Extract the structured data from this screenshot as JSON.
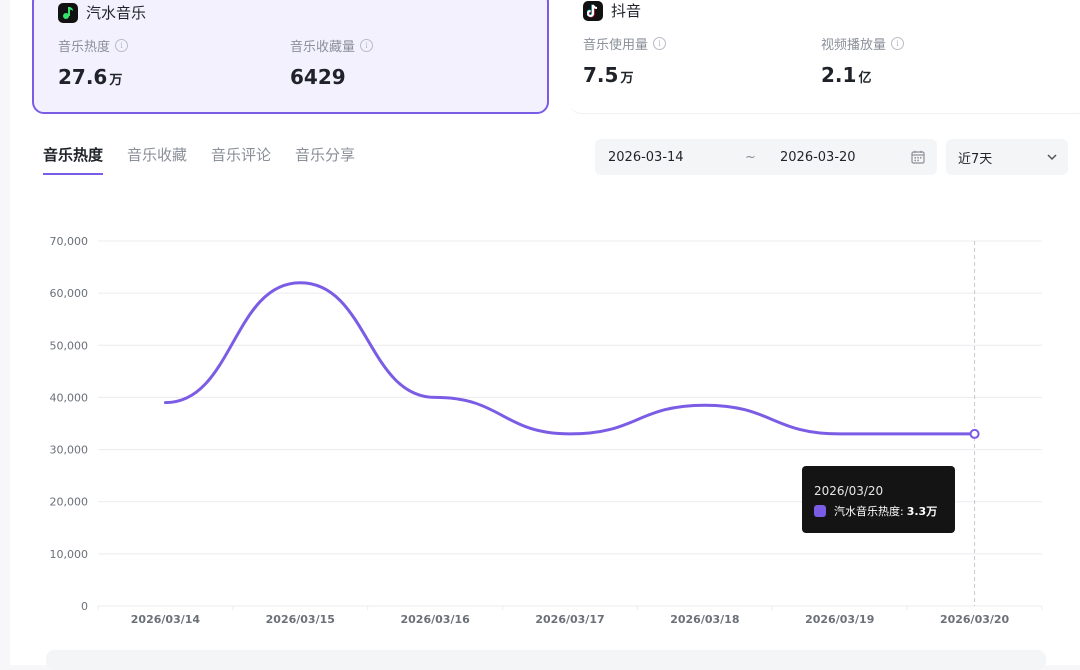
{
  "cards": [
    {
      "app": "汽水音乐",
      "logo_icon": "qishui-music-icon",
      "metrics": [
        {
          "label": "音乐热度",
          "value": "27.6",
          "unit": "万"
        },
        {
          "label": "音乐收藏量",
          "value": "6429",
          "unit": ""
        }
      ]
    },
    {
      "app": "抖音",
      "logo_icon": "douyin-icon",
      "metrics": [
        {
          "label": "音乐使用量",
          "value": "7.5",
          "unit": "万"
        },
        {
          "label": "视频播放量",
          "value": "2.1",
          "unit": "亿"
        }
      ]
    }
  ],
  "tabs": [
    "音乐热度",
    "音乐收藏",
    "音乐评论",
    "音乐分享"
  ],
  "active_tab": 0,
  "date_range": {
    "start": "2026-03-14",
    "separator": "~",
    "end": "2026-03-20"
  },
  "range_select": {
    "value": "近7天"
  },
  "tooltip": {
    "date": "2026/03/20",
    "series": "汽水音乐热度:",
    "value": "3.3万"
  },
  "colors": {
    "accent": "#7b5ce5",
    "grid": "#ececf0",
    "axis_text": "#6b7079"
  },
  "chart_data": {
    "type": "line",
    "categories": [
      "2026/03/14",
      "2026/03/15",
      "2026/03/16",
      "2026/03/17",
      "2026/03/18",
      "2026/03/19",
      "2026/03/20"
    ],
    "series": [
      {
        "name": "汽水音乐热度",
        "values": [
          39000,
          62000,
          40000,
          33000,
          38500,
          33000,
          33000
        ]
      }
    ],
    "y_ticks": [
      "0",
      "10,000",
      "20,000",
      "30,000",
      "40,000",
      "50,000",
      "60,000",
      "70,000"
    ],
    "ylim": [
      0,
      70000
    ],
    "smooth": true,
    "grid": true,
    "highlight_index": 6
  }
}
